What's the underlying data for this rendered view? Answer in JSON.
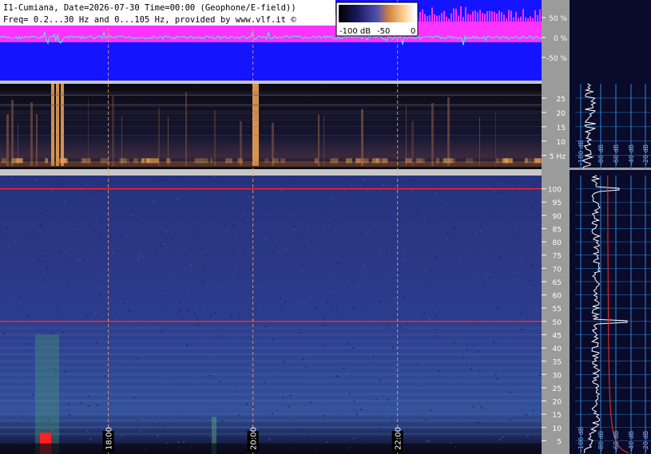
{
  "header": {
    "line1": "I1-Cumiana, Date=2026-07-30 Time=00:00 (Geophone/E-field))",
    "line2": "Freq= 0.2...30 Hz and 0...105 Hz, provided by www.vlf.it ©"
  },
  "colorbar": {
    "labels": [
      "-100 dB",
      "-50",
      "0"
    ]
  },
  "colors": {
    "waveform_bg": "#1414ff",
    "magenta_band": "#ff33ff",
    "spectro_dark": "#080818",
    "spectro_blue": "#2a3a8a",
    "right_panel": "#0a0a2a",
    "grid_line": "#2a8ad6",
    "marker_red": "#ff2222"
  },
  "chart_data": [
    {
      "type": "line",
      "name": "amplitude-strip",
      "y_ticks": [
        50,
        0,
        -50
      ],
      "y_tick_labels": [
        "50 %",
        "0 %",
        "-50 %"
      ]
    },
    {
      "type": "heatmap",
      "name": "low-freq-spectrogram",
      "ylim": [
        0.2,
        30
      ],
      "y_ticks": [
        25,
        20,
        15,
        10,
        5
      ],
      "y_tick_labels": [
        "25",
        "20",
        "15",
        "10",
        "5 Hz"
      ]
    },
    {
      "type": "heatmap",
      "name": "high-freq-spectrogram",
      "ylim": [
        0,
        105
      ],
      "y_ticks": [
        100,
        95,
        90,
        85,
        80,
        75,
        70,
        65,
        60,
        55,
        50,
        45,
        40,
        35,
        30,
        25,
        20,
        15,
        10,
        5
      ],
      "x_ticks": [
        "18:00",
        "20:00",
        "22:00"
      ],
      "x_tick_pos": [
        0.2,
        0.467,
        0.734
      ],
      "markers": [
        100,
        50
      ]
    },
    {
      "type": "line",
      "name": "spectrum-profile-top",
      "x_tick_labels": [
        "-100 dB",
        "-80 dB",
        "-60 dB",
        "-40 dB",
        "-20 dB"
      ]
    },
    {
      "type": "line",
      "name": "spectrum-profile-bottom",
      "x_tick_labels": [
        "-100 dB",
        "-80 dB",
        "-60 dB",
        "-40 dB",
        "-20 dB"
      ]
    }
  ]
}
